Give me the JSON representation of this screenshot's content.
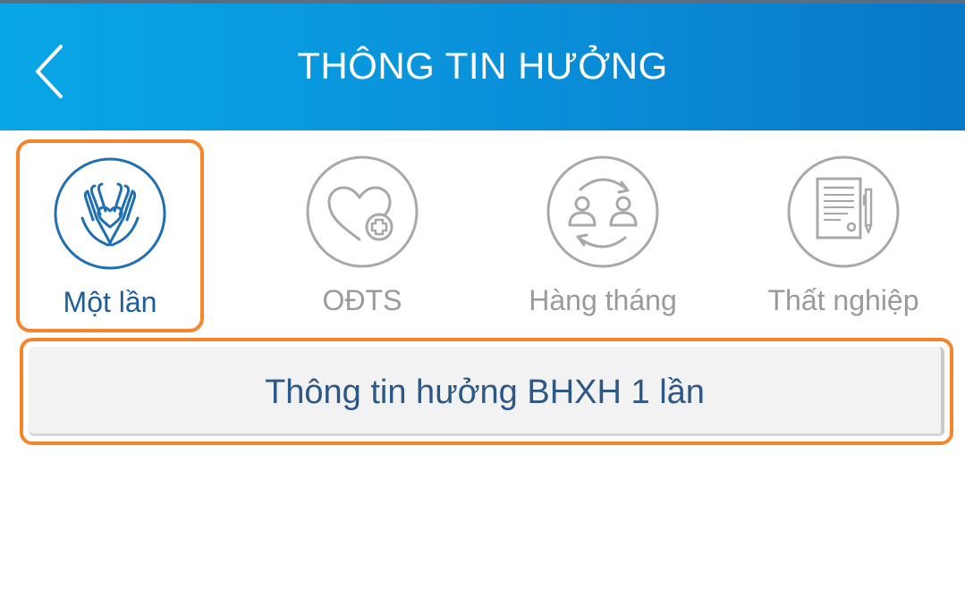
{
  "header": {
    "title": "THÔNG TIN HƯỞNG",
    "back_icon": "chevron-left-icon"
  },
  "tabs": [
    {
      "label": "Một lần",
      "icon": "hands-heart-icon",
      "selected": true
    },
    {
      "label": "OĐTS",
      "icon": "heart-plus-icon",
      "selected": false
    },
    {
      "label": "Hàng tháng",
      "icon": "people-exchange-icon",
      "selected": false
    },
    {
      "label": "Thất nghiệp",
      "icon": "document-pen-icon",
      "selected": false
    }
  ],
  "info_button": {
    "label": "Thông tin hưởng BHXH 1 lần"
  },
  "colors": {
    "header_start": "#08a7e6",
    "header_end": "#0878c8",
    "highlight": "#f5852a",
    "active_icon": "#1f6fb2",
    "inactive_icon": "#a8a8a8"
  }
}
